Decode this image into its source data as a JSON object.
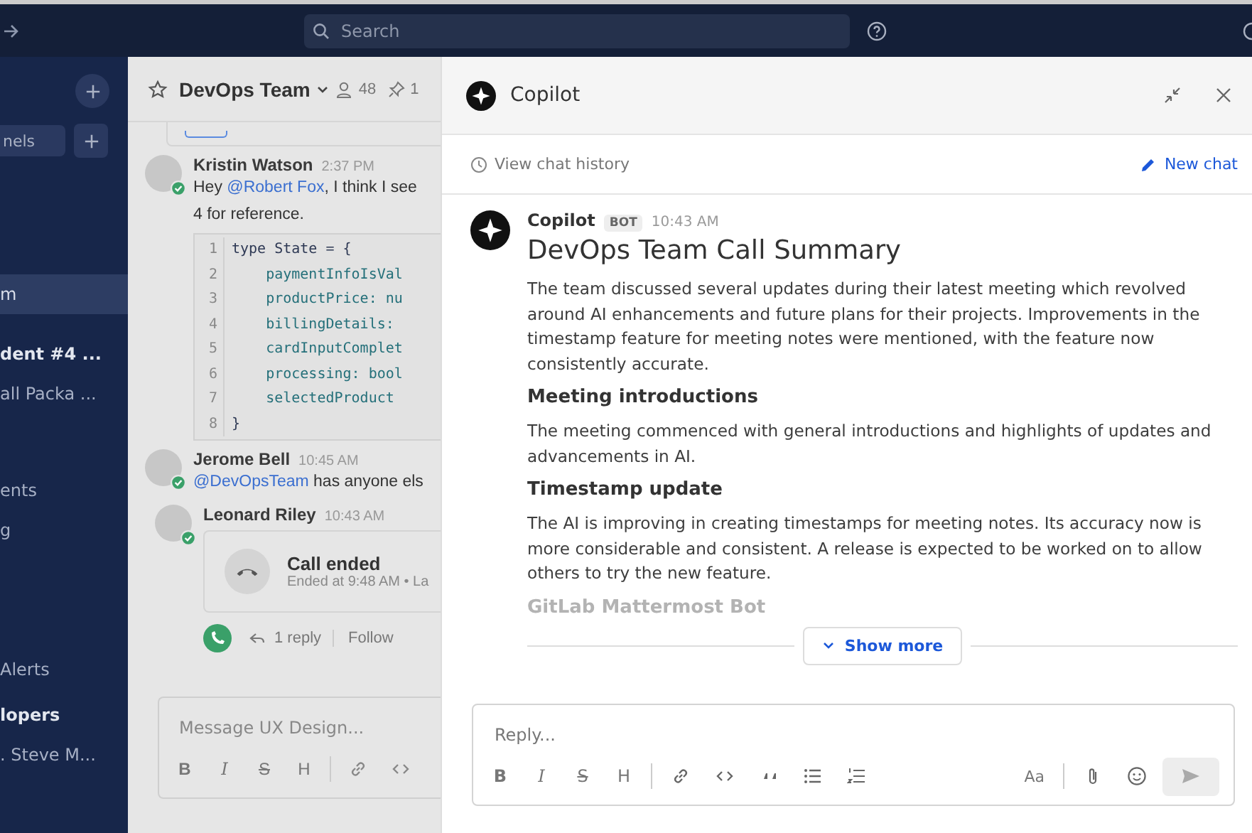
{
  "top_bar": {
    "search": {
      "placeholder": "Search"
    }
  },
  "sidebar": {
    "find_field": {
      "placeholder": "nels"
    },
    "items": [
      {
        "label": "m",
        "selected": true,
        "unread": false
      },
      {
        "label": "dent #4 ...",
        "selected": false,
        "unread": true
      },
      {
        "label": "all Packa ...",
        "selected": false,
        "unread": false
      },
      {
        "label": "ents",
        "selected": false,
        "unread": false
      },
      {
        "label": "g",
        "selected": false,
        "unread": false
      },
      {
        "label": "Alerts",
        "selected": false,
        "unread": false
      },
      {
        "label": "lopers",
        "selected": false,
        "unread": true
      },
      {
        "label": ". Steve M...",
        "selected": false,
        "unread": false
      }
    ]
  },
  "channel": {
    "title": "DevOps Team",
    "members": "48",
    "pinned": "1",
    "messages": [
      {
        "kind": "code",
        "author": "Kristin Watson",
        "time": "2:37 PM",
        "text_before": "Hey",
        "mention": "@Robert Fox",
        "text": ", I think I see",
        "text_2": "4 for reference.",
        "code": [
          {
            "num": "1",
            "text": "type State = {"
          },
          {
            "num": "2",
            "text": "    paymentInfoIsVal"
          },
          {
            "num": "3",
            "text": "    productPrice: nu"
          },
          {
            "num": "4",
            "text": "    billingDetails:"
          },
          {
            "num": "5",
            "text": "    cardInputComplet"
          },
          {
            "num": "6",
            "text": "    processing: bool"
          },
          {
            "num": "7",
            "text": "    selectedProduct"
          },
          {
            "num": "8",
            "text": "}"
          }
        ]
      },
      {
        "kind": "text",
        "author": "Jerome Bell",
        "time": "10:45 AM",
        "mention": "@DevOpsTeam",
        "text": " has anyone els"
      },
      {
        "kind": "call",
        "author": "Leonard Riley",
        "time": "10:43 AM",
        "call_title": "Call ended",
        "call_detail": "Ended at 9:48 AM • La",
        "replies": "1 reply",
        "follow": "Follow"
      }
    ],
    "composer": {
      "placeholder": "Message UX Design...",
      "format_buttons": [
        "B",
        "I",
        "S",
        "H"
      ]
    }
  },
  "copilot": {
    "title": "Copilot",
    "history": "View chat history",
    "new_chat": "New chat",
    "message": {
      "author": "Copilot",
      "badge": "BOT",
      "time": "10:43 AM",
      "heading": "DevOps Team Call Summary",
      "blocks": [
        {
          "kind": "para",
          "text": "The team discussed several updates during their latest meeting which revolved around AI enhancements and future plans for their projects. Improvements in the timestamp feature for meeting notes were mentioned, with the feature now consistently accurate."
        },
        {
          "kind": "heading",
          "text": "Meeting introductions"
        },
        {
          "kind": "para",
          "text": "The meeting commenced with general introductions and highlights of updates and advancements in AI."
        },
        {
          "kind": "heading",
          "text": "Timestamp update"
        },
        {
          "kind": "para",
          "text": "The AI is improving in creating timestamps for meeting notes. Its accuracy now is more considerable and consistent. A release is expected to be worked on to allow others to try the new feature."
        },
        {
          "kind": "faded",
          "text": "GitLab Mattermost Bot"
        }
      ]
    },
    "show_more": "Show more",
    "reply": {
      "placeholder": "Reply...",
      "format_buttons": [
        "B",
        "I",
        "S",
        "H"
      ],
      "format_label": "Aa"
    }
  }
}
